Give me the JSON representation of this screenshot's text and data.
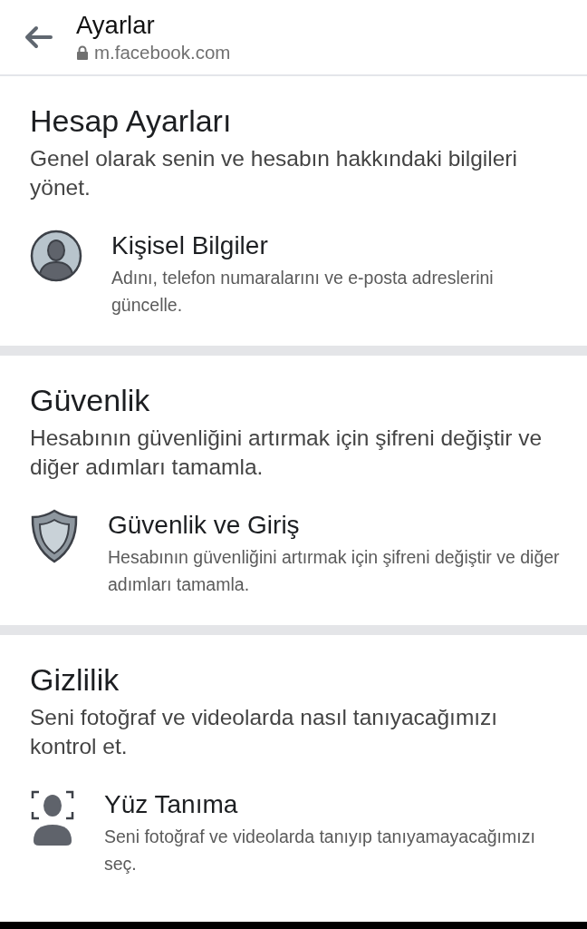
{
  "header": {
    "title": "Ayarlar",
    "url": "m.facebook.com"
  },
  "sections": [
    {
      "title": "Hesap Ayarları",
      "description": "Genel olarak senin ve hesabın hakkındaki bilgileri yönet.",
      "items": [
        {
          "kind": "person",
          "title": "Kişisel Bilgiler",
          "description": "Adını, telefon numaralarını ve e-posta adreslerini güncelle."
        }
      ]
    },
    {
      "title": "Güvenlik",
      "description": "Hesabının güvenliğini artırmak için şifreni değiştir ve diğer adımları tamamla.",
      "items": [
        {
          "kind": "shield",
          "title": "Güvenlik ve Giriş",
          "description": "Hesabının güvenliğini artırmak için şifreni değiştir ve diğer adımları tamamla."
        }
      ]
    },
    {
      "title": "Gizlilik",
      "description": "Seni fotoğraf ve videolarda nasıl tanıyacağımızı kontrol et.",
      "items": [
        {
          "kind": "face",
          "title": "Yüz Tanıma",
          "description": "Seni fotoğraf ve videolarda tanıyıp tanıyamayacağımızı seç."
        }
      ]
    }
  ]
}
